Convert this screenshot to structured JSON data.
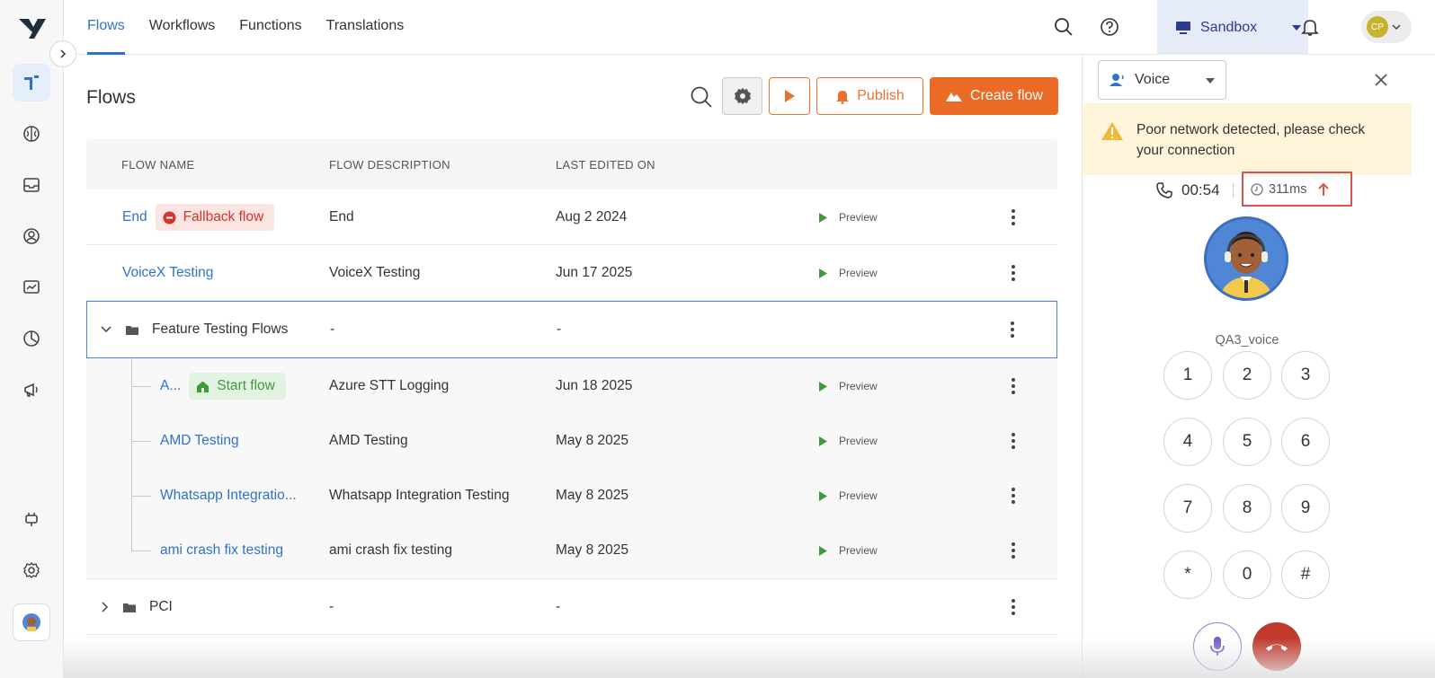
{
  "nav": {
    "tabs": [
      {
        "label": "Flows",
        "active": true
      },
      {
        "label": "Workflows",
        "active": false
      },
      {
        "label": "Functions",
        "active": false
      },
      {
        "label": "Translations",
        "active": false
      }
    ],
    "environment": "Sandbox",
    "user_initials": "CP"
  },
  "rail": {
    "icons": [
      "bot-icon",
      "brain-icon",
      "inbox-icon",
      "user-circle-icon",
      "analytics-icon",
      "pie-chart-icon",
      "megaphone-icon",
      "plug-icon",
      "settings-icon",
      "avatar"
    ]
  },
  "page": {
    "title": "Flows",
    "publish_label": "Publish",
    "create_label": "Create flow"
  },
  "table": {
    "headers": {
      "name": "FLOW NAME",
      "description": "FLOW DESCRIPTION",
      "edited": "LAST EDITED ON"
    },
    "preview_label": "Preview",
    "rows": [
      {
        "name": "End",
        "badge": "Fallback flow",
        "description": "End",
        "edited": "Aug 2 2024"
      },
      {
        "name": "VoiceX Testing",
        "description": "VoiceX Testing",
        "edited": "Jun 17 2025"
      },
      {
        "folder": "Feature Testing Flows",
        "description": "-",
        "edited": "-"
      },
      {
        "name": "A...",
        "badge": "Start flow",
        "description": "Azure STT Logging",
        "edited": "Jun 18 2025"
      },
      {
        "name": "AMD Testing",
        "description": "AMD Testing",
        "edited": "May 8 2025"
      },
      {
        "name": "Whatsapp Integratio...",
        "description": "Whatsapp Integration Testing",
        "edited": "May 8 2025"
      },
      {
        "name": "ami crash fix testing",
        "description": "ami crash fix testing",
        "edited": "May 8 2025"
      },
      {
        "folder": "PCI",
        "description": "-",
        "edited": "-"
      }
    ]
  },
  "panel": {
    "channel": "Voice",
    "warning": "Poor network detected, please check your connection",
    "timer": "00:54",
    "latency": "311ms",
    "agent_name": "QA3_voice",
    "keys": [
      "1",
      "2",
      "3",
      "4",
      "5",
      "6",
      "7",
      "8",
      "9",
      "*",
      "0",
      "#"
    ]
  },
  "colors": {
    "accent": "#2f73c7",
    "orange": "#ea6b26",
    "danger": "#d0362d",
    "success": "#3f9b3c",
    "warning_bg": "#fdf4d9"
  }
}
